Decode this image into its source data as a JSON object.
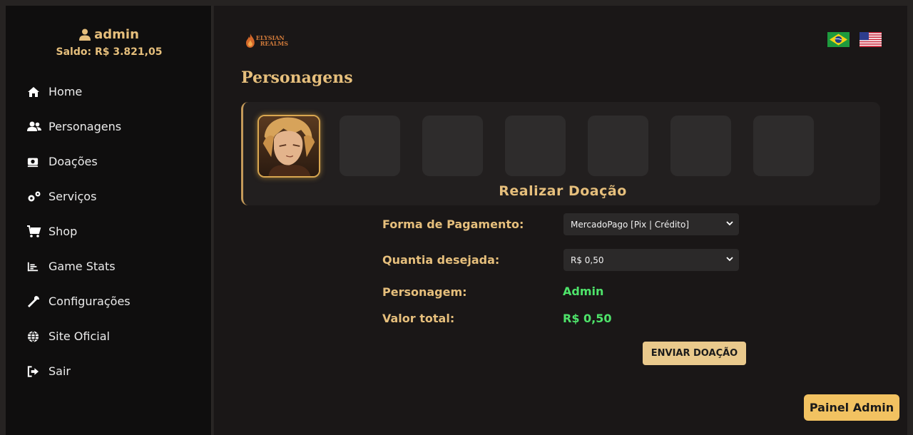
{
  "user": {
    "name": "admin",
    "balance": "Saldo: R$ 3.821,05"
  },
  "nav": [
    {
      "label": "Home",
      "icon": "home-icon"
    },
    {
      "label": "Personagens",
      "icon": "users-icon"
    },
    {
      "label": "Doações",
      "icon": "money-icon"
    },
    {
      "label": "Serviços",
      "icon": "gears-icon"
    },
    {
      "label": "Shop",
      "icon": "cart-icon"
    },
    {
      "label": "Game Stats",
      "icon": "chart-icon"
    },
    {
      "label": "Configurações",
      "icon": "wrench-icon"
    },
    {
      "label": "Site Oficial",
      "icon": "globe-icon"
    },
    {
      "label": "Sair",
      "icon": "logout-icon"
    }
  ],
  "logo": {
    "line1": "ELYSIAN",
    "line2": "REALMS"
  },
  "page": {
    "title": "Personagens"
  },
  "panel": {
    "heading": "Realizar Doação"
  },
  "form": {
    "payment_label": "Forma de Pagamento:",
    "payment_value": "MercadoPago [Pix | Crédito]",
    "amount_label": "Quantia desejada:",
    "amount_value": "R$ 0,50",
    "character_label": "Personagem:",
    "character_value": "Admin",
    "total_label": "Valor total:",
    "total_value": "R$ 0,50",
    "submit": "ENVIAR DOAÇÃO"
  },
  "admin_button": "Painel Admin",
  "colors": {
    "accent": "#e6bf7c",
    "green": "#4ee36a",
    "button": "#e9c98c",
    "admin_button": "#f2c261"
  }
}
